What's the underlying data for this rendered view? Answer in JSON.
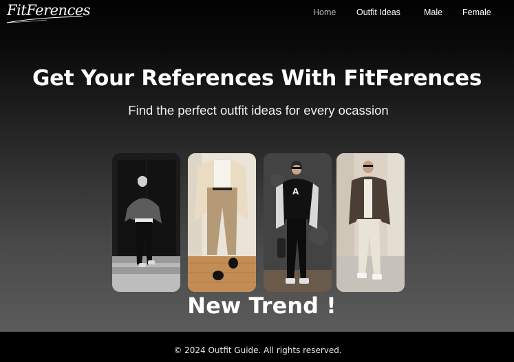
{
  "brand": {
    "logo_text": "FitFerences"
  },
  "nav": {
    "items": [
      {
        "label": "Home",
        "active": true
      },
      {
        "label": "Outfit Ideas",
        "active": false
      },
      {
        "label": "Male",
        "active": false
      },
      {
        "label": "Female",
        "active": false
      }
    ]
  },
  "hero": {
    "title": "Get Your References With FitFerences",
    "subtitle": "Find the perfect outfit ideas for every ocassion"
  },
  "gallery": {
    "cards": [
      {
        "image": "outfit-photo-grey-sweater"
      },
      {
        "image": "outfit-photo-beige-suit"
      },
      {
        "image": "outfit-photo-varsity-jacket"
      },
      {
        "image": "outfit-photo-brown-jacket"
      }
    ],
    "caption": "New Trend !"
  },
  "footer": {
    "text": "© 2024 Outfit Guide. All rights reserved."
  }
}
